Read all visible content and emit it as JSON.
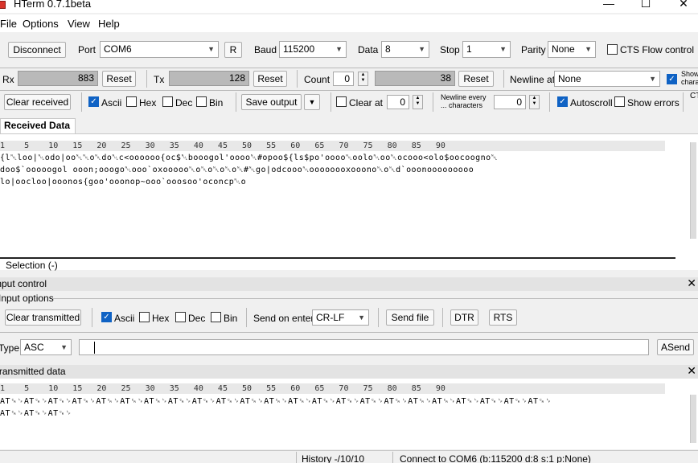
{
  "window": {
    "title": "HTerm 0.7.1beta",
    "minimize": "—",
    "maximize": "☐",
    "close": "✕"
  },
  "menu": [
    "File",
    "Options",
    "View",
    "Help"
  ],
  "toolbar": {
    "disconnect_label": "Disconnect",
    "port_label": "Port",
    "port_value": "COM6",
    "refresh_label": "R",
    "baud_label": "Baud",
    "baud_value": "115200",
    "data_label": "Data",
    "data_value": "8",
    "stop_label": "Stop",
    "stop_value": "1",
    "parity_label": "Parity",
    "parity_value": "None",
    "cts_label": "CTS Flow control"
  },
  "counters": {
    "rx_label": "Rx",
    "rx_value": "883",
    "rx_reset": "Reset",
    "tx_label": "Tx",
    "tx_value": "128",
    "tx_reset": "Reset",
    "count_label": "Count",
    "count_value": "0",
    "count_display": "38",
    "count_reset": "Reset",
    "newline_label": "Newline at",
    "newline_value": "None",
    "show_label": "Show\nchara"
  },
  "recv_options": {
    "clear_received": "Clear received",
    "ascii": "Ascii",
    "hex": "Hex",
    "dec": "Dec",
    "bin": "Bin",
    "save_output": "Save output",
    "clear_at": "Clear at",
    "clear_at_value": "0",
    "newline_every_1": "Newline every",
    "newline_every_2": "... characters",
    "newline_every_value": "0",
    "autoscroll": "Autoscroll",
    "show_errors": "Show errors",
    "cts_cut": "CT"
  },
  "received": {
    "tab_label": "Received Data",
    "ruler": "1    5    10   15   20   25   30   35   40   45   50   55   60   65   70   75   80   85   90",
    "lines": [
      "{l␀loo|␀odo|oo␀␀o␀do␀c<oooooo{oc$␀booogol'oooo␀#opoo${ls$po'oooo␀oolo␀oo␀ocooo<olo$oocoogno␀",
      "doo$`ooooogol ooon;ooogo␀ooo`oxooooo␀o␀o␀o␀o␀#␀go|odcooo␀oooooooxooono␀o␀d`ooonooooooooo",
      "lo|oocloo|ooonos{goo'ooonop~ooo`ooosoo'oconcp␀o"
    ],
    "selection_label": "Selection (-)"
  },
  "input_control": {
    "header": "Input control",
    "options_label": "Input options",
    "clear_transmitted": "Clear transmitted",
    "ascii": "Ascii",
    "hex": "Hex",
    "dec": "Dec",
    "bin": "Bin",
    "send_on_enter_label": "Send on enter",
    "send_on_enter_value": "CR-LF",
    "send_file": "Send file",
    "dtr": "DTR",
    "rts": "RTS",
    "type_label": "Type",
    "type_value": "ASC",
    "input_value": "",
    "asend": "ASend"
  },
  "transmitted": {
    "header": "Transmitted data",
    "ruler": "1    5    10   15   20   25   30   35   40   45   50   55   60   65   70   75   80   85   90",
    "lines": [
      "AT␍␊AT␍␊AT␍␊AT␍␊AT␍␊AT␍␊AT␍␊AT␍␊AT␍␊AT␍␊AT␍␊AT␍␊AT␍␊AT␍␊AT␍␊AT␍␊AT␍␊AT␍␊AT␍␊AT␍␊AT␍␊AT␍␊AT␍␊",
      "AT␍␊AT␍␊AT␍␊"
    ]
  },
  "status": {
    "history": "History -/10/10",
    "connection": "Connect to COM6 (b:115200 d:8 s:1 p:None)"
  },
  "colors": {
    "accent": "#0f62c4",
    "close_red": "#e81123"
  }
}
